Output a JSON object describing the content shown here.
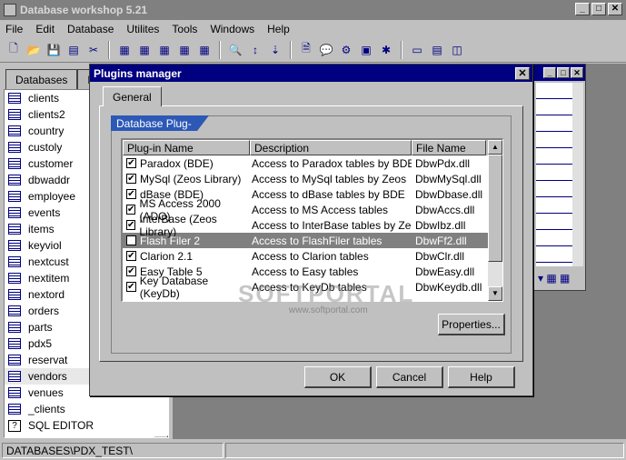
{
  "app": {
    "title": "Database workshop 5.21"
  },
  "menu": [
    "File",
    "Edit",
    "Database",
    "Utilites",
    "Tools",
    "Windows",
    "Help"
  ],
  "left_panel": {
    "tabs": [
      "Databases",
      "F"
    ],
    "tables": [
      "clients",
      "clients2",
      "country",
      "custoly",
      "customer",
      "dbwaddr",
      "employee",
      "events",
      "items",
      "keyviol",
      "nextcust",
      "nextitem",
      "nextord",
      "orders",
      "parts",
      "pdx5",
      "reservat",
      "vendors",
      "venues",
      "_clients"
    ],
    "sql_editor": "SQL EDITOR",
    "selected": "vendors"
  },
  "status_bar": {
    "path": "DATABASES\\PDX_TEST\\"
  },
  "dialog": {
    "title": "Plugins manager",
    "tab": "General",
    "group": "Database Plug-ins",
    "columns": [
      "Plug-in Name",
      "Description",
      "File Name"
    ],
    "rows": [
      {
        "name": "Paradox (BDE)",
        "desc": "Access to Paradox tables by BDE",
        "file": "DbwPdx.dll",
        "checked": "✔"
      },
      {
        "name": "MySql (Zeos Library)",
        "desc": "Access to MySql tables by Zeos",
        "file": "DbwMySql.dll",
        "checked": "✔"
      },
      {
        "name": "dBase (BDE)",
        "desc": "Access to dBase tables by BDE",
        "file": "DbwDbase.dll",
        "checked": "✔"
      },
      {
        "name": "MS Access 2000 (ADO)",
        "desc": "Access to MS Access tables",
        "file": "DbwAccs.dll",
        "checked": "✔"
      },
      {
        "name": "InterBase (Zeos Library)",
        "desc": "Access to InterBase tables by Zeos",
        "file": "DbwIbz.dll",
        "checked": "✔"
      },
      {
        "name": "Flash Filer 2",
        "desc": "Access to FlashFiler tables",
        "file": "DbwFf2.dll",
        "checked": ""
      },
      {
        "name": "Clarion 2.1",
        "desc": "Access to Clarion tables",
        "file": "DbwClr.dll",
        "checked": "✔"
      },
      {
        "name": "Easy Table 5",
        "desc": "Access to Easy tables",
        "file": "DbwEasy.dll",
        "checked": "✔"
      },
      {
        "name": "Key Database (KeyDb)",
        "desc": "Access to KeyDb tables",
        "file": "DbwKeydb.dll",
        "checked": "✔"
      }
    ],
    "properties_btn": "Properties...",
    "ok_btn": "OK",
    "cancel_btn": "Cancel",
    "help_btn": "Help"
  },
  "watermark": {
    "main": "SOFTPORTAL",
    "sub": "www.softportal.com"
  }
}
